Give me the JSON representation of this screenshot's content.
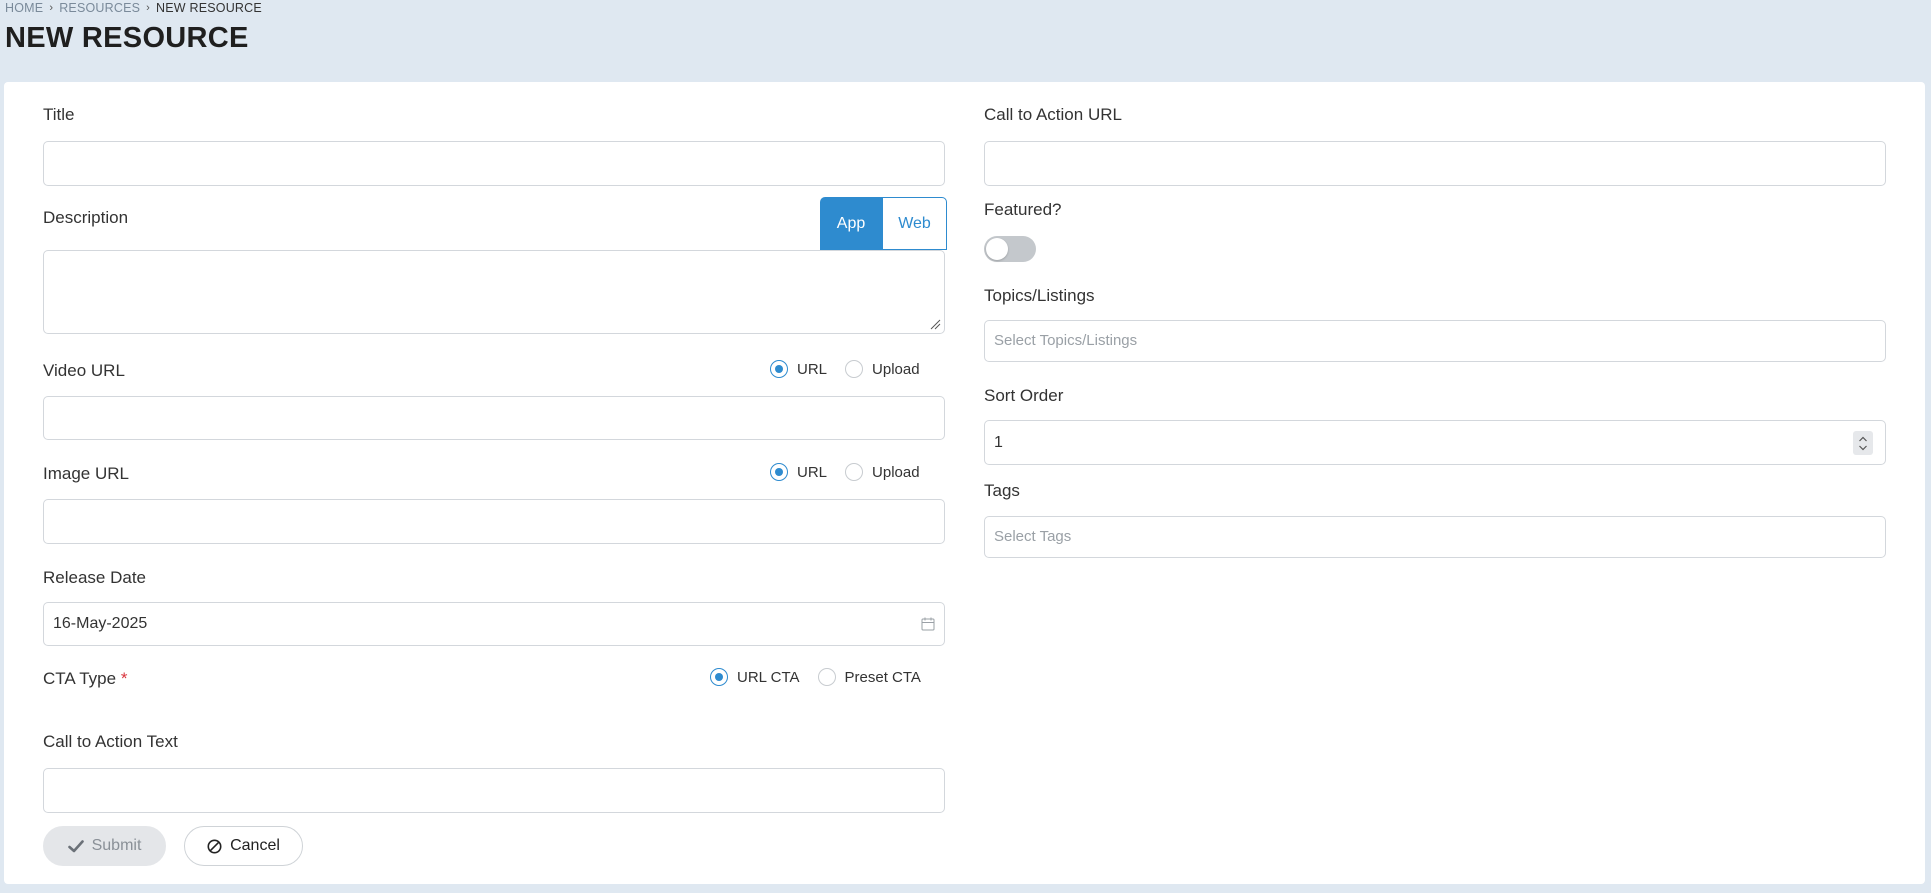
{
  "breadcrumb": {
    "home": "HOME",
    "resources": "RESOURCES",
    "current": "NEW RESOURCE"
  },
  "page": {
    "title": "NEW RESOURCE"
  },
  "left": {
    "title_label": "Title",
    "title_value": "",
    "description_label": "Description",
    "description_tabs": [
      {
        "label": "App",
        "active": true
      },
      {
        "label": "Web",
        "active": false
      }
    ],
    "video_url_label": "Video URL",
    "video_source_options": [
      {
        "label": "URL",
        "checked": true
      },
      {
        "label": "Upload",
        "checked": false
      }
    ],
    "image_url_label": "Image URL",
    "image_source_options": [
      {
        "label": "URL",
        "checked": true
      },
      {
        "label": "Upload",
        "checked": false
      }
    ],
    "release_date_label": "Release Date",
    "release_date_value": "16-May-2025",
    "cta_type_label": "CTA Type",
    "cta_required_mark": "*",
    "cta_type_options": [
      {
        "label": "URL CTA",
        "checked": true
      },
      {
        "label": "Preset CTA",
        "checked": false
      }
    ],
    "cta_text_label": "Call to Action Text",
    "cta_text_value": ""
  },
  "right": {
    "cta_url_label": "Call to Action URL",
    "cta_url_value": "",
    "featured_label": "Featured?",
    "featured_on": false,
    "topics_label": "Topics/Listings",
    "topics_placeholder": "Select Topics/Listings",
    "sort_order_label": "Sort Order",
    "sort_order_value": "1",
    "tags_label": "Tags",
    "tags_placeholder": "Select Tags"
  },
  "actions": {
    "submit_label": "Submit",
    "cancel_label": "Cancel"
  },
  "colors": {
    "accent": "#2e8bcf",
    "background": "#dfe8f1",
    "required": "#d9363e"
  }
}
